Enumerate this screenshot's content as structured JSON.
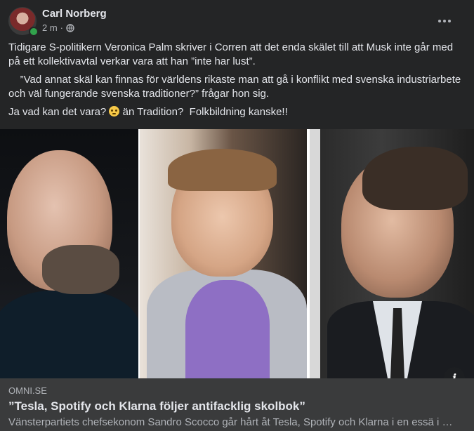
{
  "post": {
    "author": "Carl Norberg",
    "time": "2 m",
    "separator": "·",
    "audience_icon": "globe-icon",
    "more_icon": "more-options-icon",
    "paragraphs": [
      "Tidigare S-politikern Veronica Palm skriver i Corren att det enda skälet till att Musk inte går med på ett kollektivavtal verkar vara att han ”inte har lust”.",
      "    ”Vad annat skäl kan finnas för världens rikaste man att gå i konflikt med svenska industriarbete och väl fungerande svenska traditioner?” frågar hon sig."
    ],
    "last_line": {
      "before_emoji": "Ja vad kan det vara? ",
      "emoji": "face-with-rolling-eyes-emoji",
      "after_emoji": " än Tradition?  Folkbildning kanske!!"
    }
  },
  "link_preview": {
    "domain": "OMNI.SE",
    "title": "”Tesla, Spotify och Klarna följer antifacklig skolbok”",
    "description": "Vänsterpartiets chefsekonom Sandro Scocco går hårt åt Tesla, Spotify och Klarna i en essä i …",
    "info_label": "i"
  },
  "colors": {
    "background": "#242526",
    "preview_background": "#3a3b3c",
    "text_primary": "#e4e6eb",
    "text_secondary": "#b0b3b8",
    "online_status": "#31a24c"
  }
}
